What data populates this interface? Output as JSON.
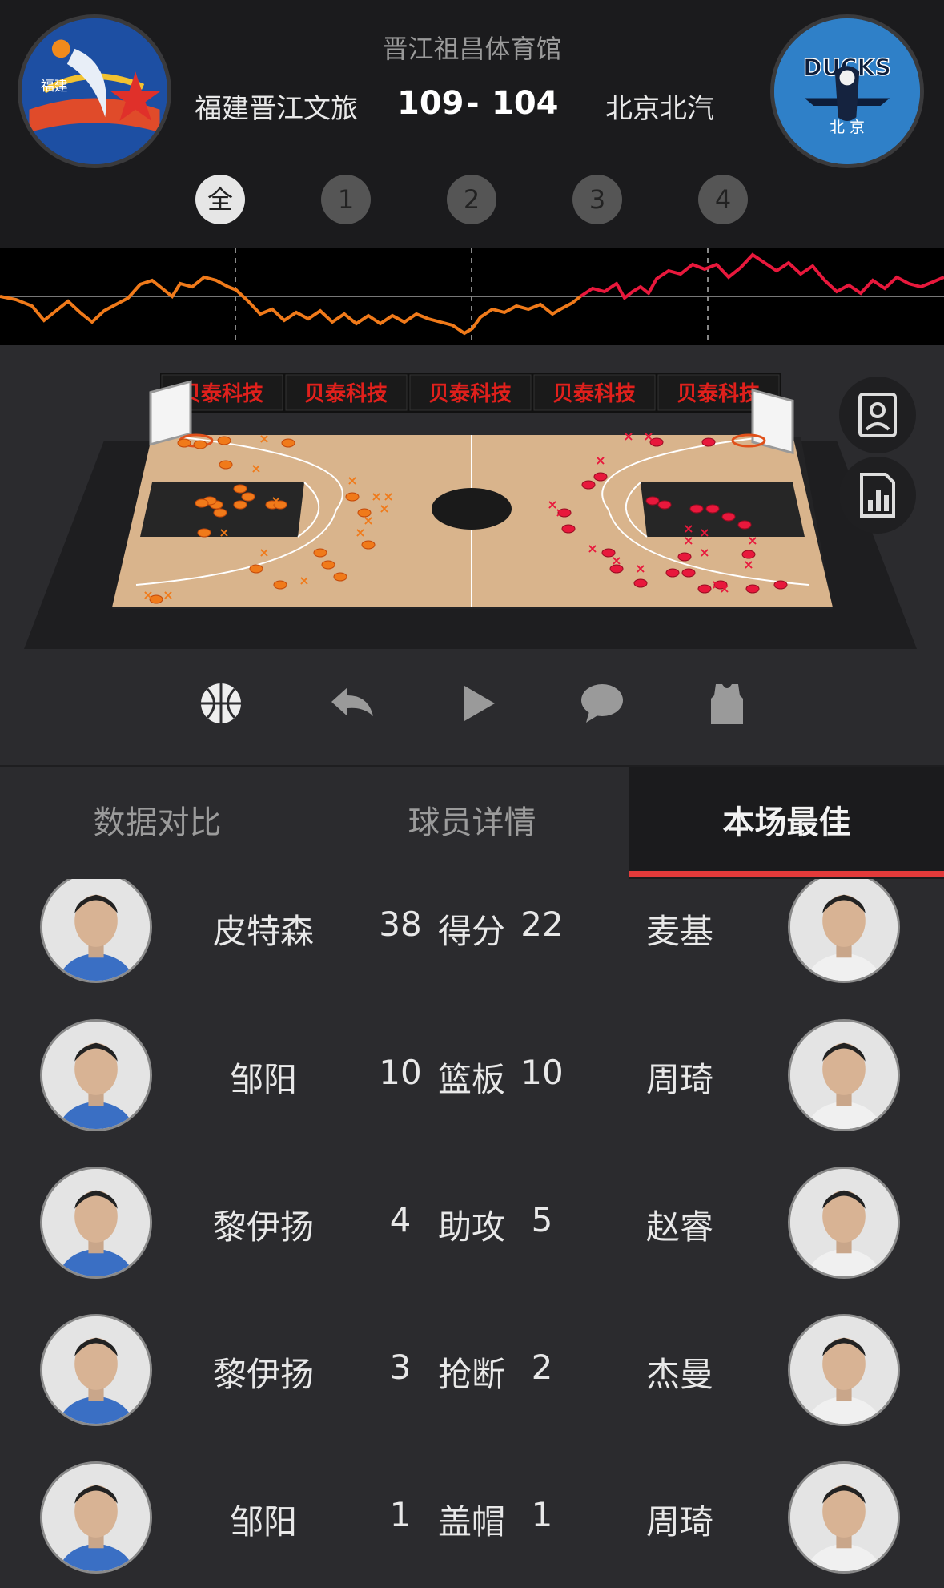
{
  "game": {
    "venue": "晋江祖昌体育馆",
    "home_team": "福建晋江文旅",
    "away_team": "北京北汽",
    "home_score": "109",
    "score_sep": "-",
    "away_score": "104",
    "home_logo_text": "福建",
    "away_logo_text": "DUCKS",
    "away_logo_sub": "北 京"
  },
  "periods": [
    {
      "label": "全",
      "active": true
    },
    {
      "label": "1",
      "active": false
    },
    {
      "label": "2",
      "active": false
    },
    {
      "label": "3",
      "active": false
    },
    {
      "label": "4",
      "active": false
    }
  ],
  "sponsor": {
    "text": "贝泰科技",
    "count": 5
  },
  "colors": {
    "accent": "#e23a3a",
    "home_trend": "#f07a1a",
    "away_trend": "#e8183c",
    "court_wood": "#d9b48c"
  },
  "side_buttons": [
    {
      "icon": "player-card-icon"
    },
    {
      "icon": "stats-chart-icon"
    }
  ],
  "toolbar": [
    {
      "icon": "basketball-icon"
    },
    {
      "icon": "undo-icon"
    },
    {
      "icon": "play-icon"
    },
    {
      "icon": "chat-icon"
    },
    {
      "icon": "jersey-icon"
    }
  ],
  "tabs": [
    {
      "label": "数据对比",
      "active": false
    },
    {
      "label": "球员详情",
      "active": false
    },
    {
      "label": "本场最佳",
      "active": true
    }
  ],
  "best_players": [
    {
      "home_name": "皮特森",
      "home_value": "38",
      "stat": "得分",
      "away_value": "22",
      "away_name": "麦基"
    },
    {
      "home_name": "邹阳",
      "home_value": "10",
      "stat": "篮板",
      "away_value": "10",
      "away_name": "周琦"
    },
    {
      "home_name": "黎伊扬",
      "home_value": "4",
      "stat": "助攻",
      "away_value": "5",
      "away_name": "赵睿"
    },
    {
      "home_name": "黎伊扬",
      "home_value": "3",
      "stat": "抢断",
      "away_value": "2",
      "away_name": "杰曼"
    },
    {
      "home_name": "邹阳",
      "home_value": "1",
      "stat": "盖帽",
      "away_value": "1",
      "away_name": "周琦"
    }
  ]
}
